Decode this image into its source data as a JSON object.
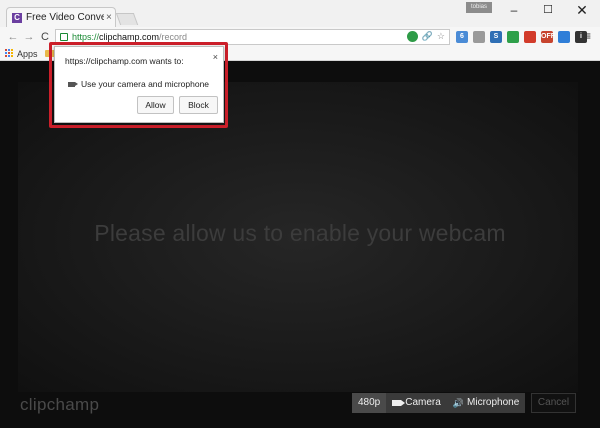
{
  "browser": {
    "tab": {
      "favicon_letter": "C",
      "title": "Free Video Converte",
      "close": "×"
    },
    "user_badge": "tobias",
    "window_controls": {
      "minimize": "–",
      "maximize": "☐",
      "close": "✕"
    },
    "toolbar": {
      "back": "←",
      "forward": "→",
      "reload": "C"
    },
    "address": {
      "scheme": "https://",
      "host": "clipchamp.com",
      "path": "/record"
    },
    "omnibox_icons": {
      "link": "🔗",
      "star": "☆"
    },
    "extensions": [
      {
        "name": "extension-6",
        "label": "6",
        "color": "#4a8bd6"
      },
      {
        "name": "extension-abp",
        "label": "",
        "color": "#9a9a9a"
      },
      {
        "name": "extension-s",
        "label": "S",
        "color": "#2f6fb5"
      },
      {
        "name": "extension-green",
        "label": "",
        "color": "#2fa04a"
      },
      {
        "name": "extension-red",
        "label": "",
        "color": "#d23b2a"
      },
      {
        "name": "extension-off",
        "label": "OFF",
        "color": "#c7442e"
      },
      {
        "name": "extension-blue",
        "label": "",
        "color": "#2f7ed8"
      },
      {
        "name": "extension-info",
        "label": "i",
        "color": "#333333"
      }
    ],
    "menu": "≡",
    "bookmarks": {
      "apps_label": "Apps"
    }
  },
  "popup": {
    "title": "https://clipchamp.com wants to:",
    "permission": "Use your camera and microphone",
    "allow": "Allow",
    "block": "Block",
    "close": "×",
    "highlight_color": "#cc1f2a"
  },
  "page": {
    "prompt": "Please allow us to enable your webcam",
    "logo": "clipchamp",
    "controls": {
      "resolution": "480p",
      "camera": "Camera",
      "microphone": "Microphone",
      "cancel": "Cancel"
    }
  }
}
